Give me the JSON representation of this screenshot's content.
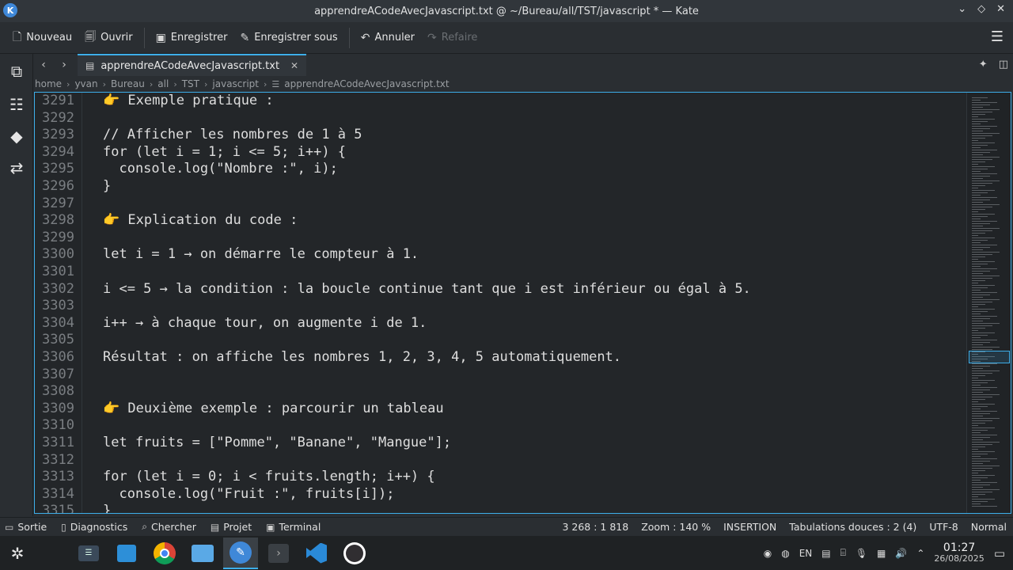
{
  "window": {
    "title": "apprendreACodeAvecJavascript.txt @ ~/Bureau/all/TST/javascript * — Kate",
    "app_icon_letter": "K"
  },
  "toolbar": {
    "new_label": "Nouveau",
    "open_label": "Ouvrir",
    "save_label": "Enregistrer",
    "save_as_label": "Enregistrer sous",
    "undo_label": "Annuler",
    "redo_label": "Refaire"
  },
  "tab": {
    "label": "apprendreACodeAvecJavascript.txt"
  },
  "breadcrumb": [
    "home",
    "yvan",
    "Bureau",
    "all",
    "TST",
    "javascript",
    "apprendreACodeAvecJavascript.txt"
  ],
  "editor": {
    "lines": [
      {
        "num": "3291",
        "text": "👉 Exemple pratique :"
      },
      {
        "num": "3292",
        "text": ""
      },
      {
        "num": "3293",
        "text": "// Afficher les nombres de 1 à 5"
      },
      {
        "num": "3294",
        "text": "for (let i = 1; i <= 5; i++) {"
      },
      {
        "num": "3295",
        "text": "  console.log(\"Nombre :\", i);"
      },
      {
        "num": "3296",
        "text": "}"
      },
      {
        "num": "3297",
        "text": ""
      },
      {
        "num": "3298",
        "text": "👉 Explication du code :"
      },
      {
        "num": "3299",
        "text": ""
      },
      {
        "num": "3300",
        "text": "let i = 1 → on démarre le compteur à 1."
      },
      {
        "num": "3301",
        "text": ""
      },
      {
        "num": "3302",
        "text": "i <= 5 → la condition : la boucle continue tant que i est inférieur ou égal à 5."
      },
      {
        "num": "3303",
        "text": ""
      },
      {
        "num": "3304",
        "text": "i++ → à chaque tour, on augmente i de 1."
      },
      {
        "num": "3305",
        "text": ""
      },
      {
        "num": "3306",
        "text": "Résultat : on affiche les nombres 1, 2, 3, 4, 5 automatiquement."
      },
      {
        "num": "3307",
        "text": ""
      },
      {
        "num": "3308",
        "text": ""
      },
      {
        "num": "3309",
        "text": "👉 Deuxième exemple : parcourir un tableau"
      },
      {
        "num": "3310",
        "text": ""
      },
      {
        "num": "3311",
        "text": "let fruits = [\"Pomme\", \"Banane\", \"Mangue\"];"
      },
      {
        "num": "3312",
        "text": ""
      },
      {
        "num": "3313",
        "text": "for (let i = 0; i < fruits.length; i++) {"
      },
      {
        "num": "3314",
        "text": "  console.log(\"Fruit :\", fruits[i]);"
      },
      {
        "num": "3315",
        "text": "}"
      }
    ]
  },
  "statusbar": {
    "output_label": "Sortie",
    "diagnostics_label": "Diagnostics",
    "search_label": "Chercher",
    "project_label": "Projet",
    "terminal_label": "Terminal",
    "cursor_pos": "3 268 : 1 818",
    "zoom": "Zoom : 140 %",
    "mode": "INSERTION",
    "indent": "Tabulations douces : 2 (4)",
    "encoding": "UTF-8",
    "input_mode": "Normal"
  },
  "taskbar": {
    "keyboard_layout": "EN",
    "time": "01:27",
    "date": "26/08/2025"
  },
  "colors": {
    "accent": "#3daee9",
    "editor_bg": "#232629",
    "chrome_bg": "#2a2e32"
  }
}
